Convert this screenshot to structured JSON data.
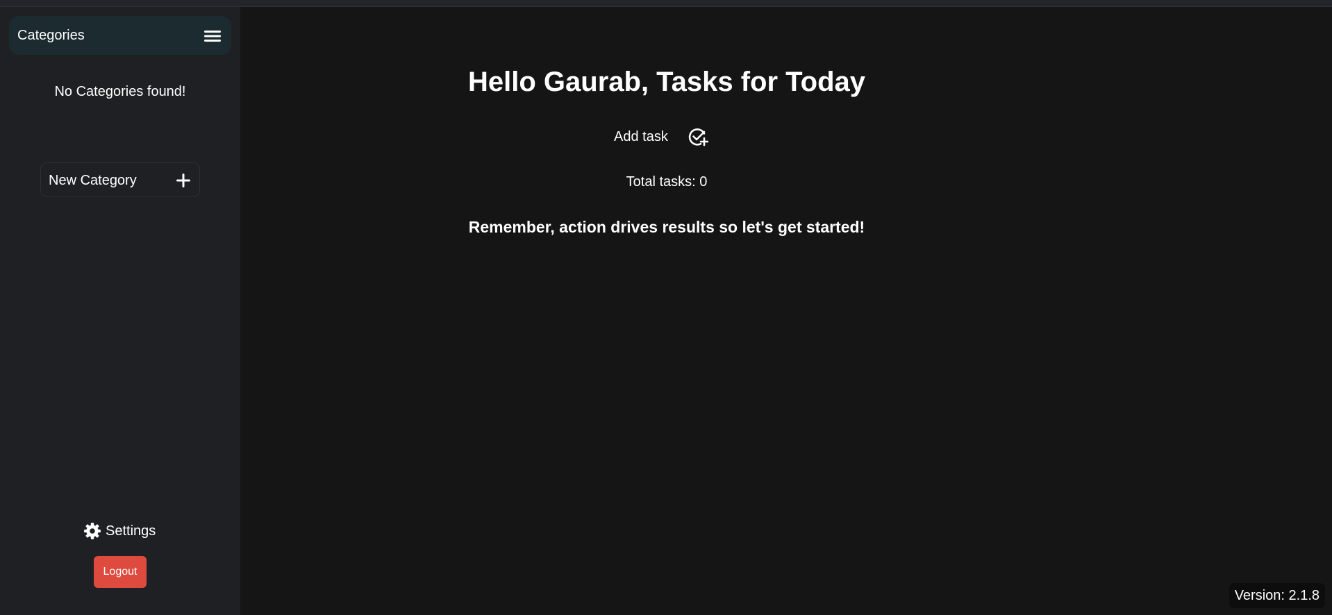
{
  "sidebar": {
    "header_title": "Categories",
    "empty_message": "No Categories found!",
    "new_category_label": "New Category",
    "settings_label": "Settings",
    "logout_label": "Logout"
  },
  "main": {
    "heading": "Hello Gaurab, Tasks for Today",
    "add_task_label": "Add task",
    "total_tasks": "Total tasks: 0",
    "motto": "Remember, action drives results so let's get started!"
  },
  "footer": {
    "version": "Version: 2.1.8"
  },
  "icons": {
    "menu": "hamburger-menu-icon",
    "plus": "plus-icon",
    "gear": "gear-icon",
    "add_task": "check-circle-plus-icon"
  },
  "colors": {
    "background": "#151516",
    "sidebar": "#1f2023",
    "category_header": "#1b2b30",
    "logout": "#df4a3f"
  }
}
